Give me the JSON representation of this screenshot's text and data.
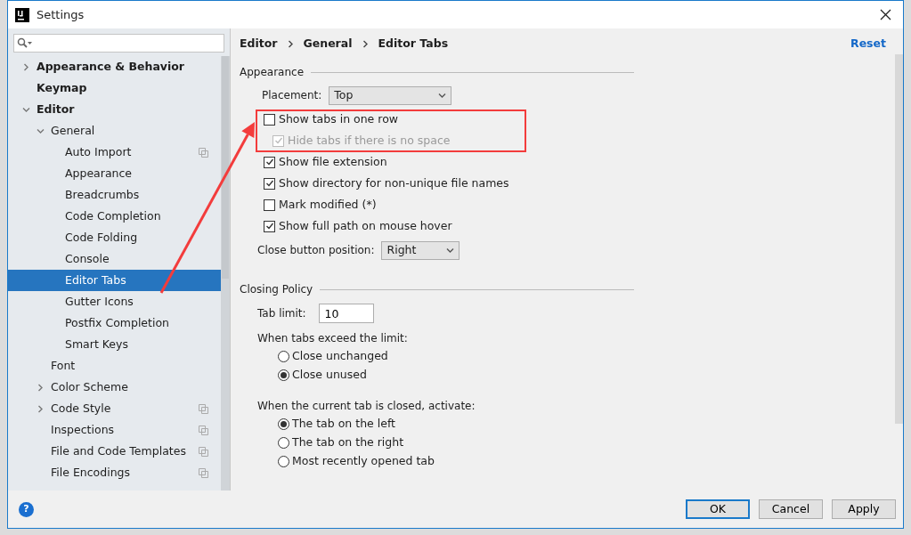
{
  "window": {
    "title": "Settings"
  },
  "tree": [
    {
      "label": "Appearance & Behavior",
      "expanded": false,
      "selected": false,
      "project_level": false
    },
    {
      "label": "Keymap",
      "selected": false,
      "project_level": false
    },
    {
      "label": "Editor",
      "expanded": true,
      "selected": false,
      "project_level": false,
      "children": [
        {
          "label": "General",
          "expanded": true,
          "selected": false,
          "project_level": false,
          "children": [
            {
              "label": "Auto Import",
              "selected": false,
              "project_level": true
            },
            {
              "label": "Appearance",
              "selected": false,
              "project_level": false
            },
            {
              "label": "Breadcrumbs",
              "selected": false,
              "project_level": false
            },
            {
              "label": "Code Completion",
              "selected": false,
              "project_level": false
            },
            {
              "label": "Code Folding",
              "selected": false,
              "project_level": false
            },
            {
              "label": "Console",
              "selected": false,
              "project_level": false
            },
            {
              "label": "Editor Tabs",
              "selected": true,
              "project_level": false
            },
            {
              "label": "Gutter Icons",
              "selected": false,
              "project_level": false
            },
            {
              "label": "Postfix Completion",
              "selected": false,
              "project_level": false
            },
            {
              "label": "Smart Keys",
              "selected": false,
              "project_level": false
            }
          ]
        },
        {
          "label": "Font",
          "selected": false,
          "project_level": false
        },
        {
          "label": "Color Scheme",
          "expanded": false,
          "selected": false,
          "project_level": false
        },
        {
          "label": "Code Style",
          "expanded": false,
          "selected": false,
          "project_level": true
        },
        {
          "label": "Inspections",
          "selected": false,
          "project_level": true
        },
        {
          "label": "File and Code Templates",
          "selected": false,
          "project_level": true
        },
        {
          "label": "File Encodings",
          "selected": false,
          "project_level": true
        }
      ]
    }
  ],
  "breadcrumb": [
    "Editor",
    "General",
    "Editor Tabs"
  ],
  "reset": "Reset",
  "sections": [
    {
      "title": "Appearance",
      "rows": [
        {
          "kind": "select",
          "label": "Placement:",
          "value": "Top"
        },
        {
          "kind": "checkbox",
          "label": "Show tabs in one row",
          "checked": false,
          "disabled": false,
          "annotated": true,
          "children": [
            {
              "kind": "checkbox",
              "label": "Hide tabs if there is no space",
              "checked": true,
              "disabled": true
            }
          ]
        },
        {
          "kind": "checkbox",
          "label": "Show file extension",
          "checked": true,
          "disabled": false,
          "annotated": false
        },
        {
          "kind": "checkbox",
          "label": "Show directory for non-unique file names",
          "checked": true,
          "disabled": false,
          "annotated": false
        },
        {
          "kind": "checkbox",
          "label": "Mark modified (*)",
          "checked": false,
          "disabled": false,
          "annotated": false
        },
        {
          "kind": "checkbox",
          "label": "Show full path on mouse hover",
          "checked": true,
          "disabled": false,
          "annotated": false
        },
        {
          "kind": "select",
          "label": "Close button position:",
          "value": "Right"
        }
      ]
    },
    {
      "title": "Closing Policy",
      "rows": [
        {
          "kind": "input",
          "label": "Tab limit:",
          "value": "10"
        },
        {
          "kind": "radios",
          "label": "When tabs exceed the limit:",
          "options": [
            {
              "label": "Close unchanged",
              "selected": false
            },
            {
              "label": "Close unused",
              "selected": true
            }
          ]
        },
        {
          "kind": "radios",
          "label": "When the current tab is closed, activate:",
          "options": [
            {
              "label": "The tab on the left",
              "selected": true
            },
            {
              "label": "The tab on the right",
              "selected": false
            },
            {
              "label": "Most recently opened tab",
              "selected": false
            }
          ]
        }
      ]
    }
  ],
  "help": "?",
  "buttons": [
    {
      "label": "OK",
      "default": true
    },
    {
      "label": "Cancel",
      "default": false
    },
    {
      "label": "Apply",
      "default": false
    }
  ]
}
